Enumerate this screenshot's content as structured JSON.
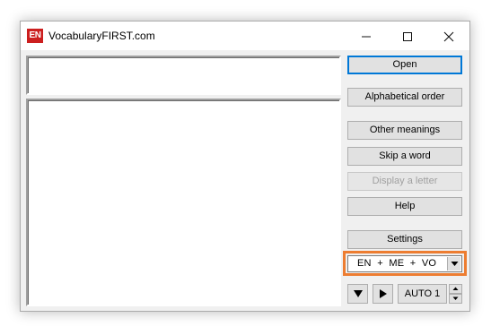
{
  "window": {
    "title": "VocabularyFIRST.com",
    "icon_text": "EN",
    "icon_color": "#cc1f1f",
    "controls": {
      "minimize_icon": "minimize-icon",
      "maximize_icon": "maximize-icon",
      "close_icon": "close-icon"
    }
  },
  "buttons": {
    "open": "Open",
    "alphabetical": "Alphabetical order",
    "other_meanings": "Other meanings",
    "skip": "Skip a word",
    "display_letter": "Display a letter",
    "help": "Help",
    "settings": "Settings"
  },
  "mode_select": {
    "value": "EN  +  ME  +  VO",
    "highlight_color": "#ed7d31"
  },
  "playback": {
    "down_icon": "triangle-down-icon",
    "play_icon": "play-icon",
    "auto_value": "AUTO 1"
  }
}
